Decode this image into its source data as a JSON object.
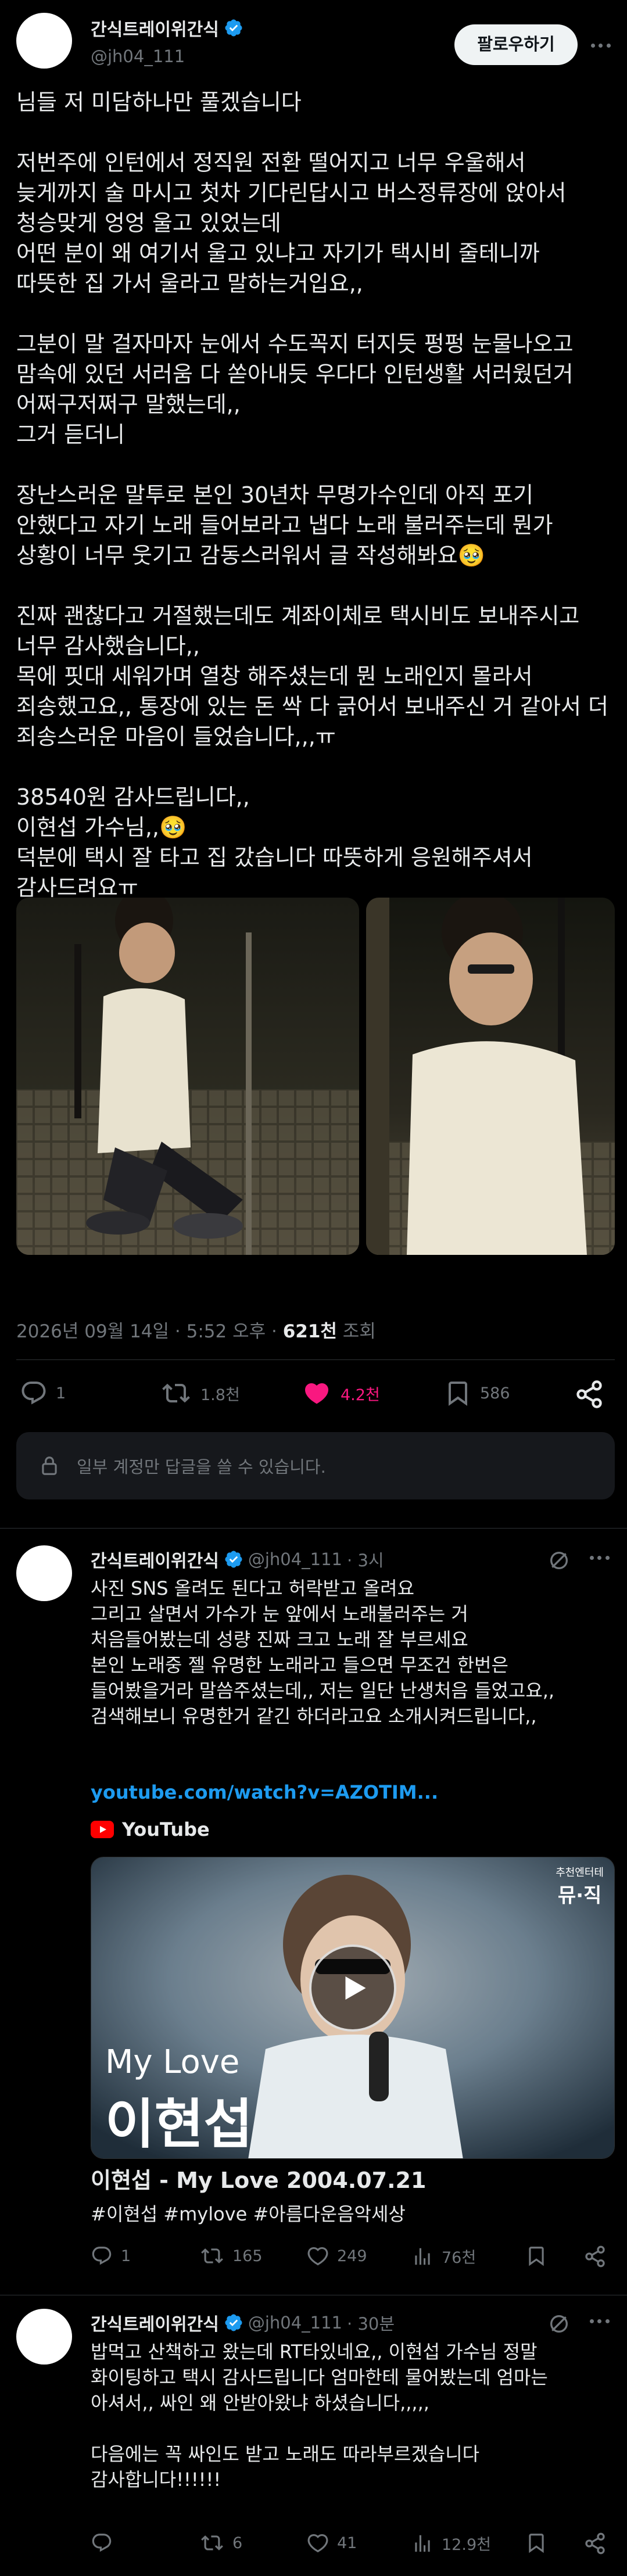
{
  "author": {
    "display_name": "간식트레이위간식",
    "handle": "@jh04_111",
    "follow_label": "팔로우하기"
  },
  "post": {
    "text": "님들 저 미담하나만 풀겠습니다\n\n저번주에 인턴에서 정직원 전환 떨어지고 너무 우울해서\n늦게까지 술 마시고 첫차 기다린답시고 버스정류장에 앉아서\n청승맞게 엉엉 울고 있었는데\n어떤 분이 왜 여기서 울고 있냐고 자기가 택시비 줄테니까\n따뜻한 집 가서 울라고 말하는거입요,,\n\n그분이 말 걸자마자 눈에서 수도꼭지 터지듯 펑펑 눈물나오고\n맘속에 있던 서러움 다 쏟아내듯 우다다 인턴생활 서러웠던거\n어쩌구저쩌구 말했는데,,\n그거 듣더니\n\n장난스러운 말투로 본인 30년차 무명가수인데 아직 포기\n안했다고 자기 노래 들어보라고 냅다 노래 불러주는데 뭔가\n상황이 너무 웃기고 감동스러워서 글 작성해봐요🥹\n\n진짜 괜찮다고 거절했는데도 계좌이체로 택시비도 보내주시고\n너무 감사했습니다,,\n목에 핏대 세워가며 열창 해주셨는데 뭔 노래인지 몰라서\n죄송했고요,, 통장에 있는 돈 싹 다 긁어서 보내주신 거 같아서 더\n죄송스러운 마음이 들었습니다,,,ㅠ\n\n38540원 감사드립니다,,\n이현섭 가수님,,🥹\n덕분에 택시 잘 타고 집 갔습니다 따뜻하게 응원해주셔서\n감사드려요ㅠ",
    "date": "2026년 09월 14일 · 5:52 오후 · ",
    "views": "621천",
    "views_label": " 조회",
    "replies": "1",
    "reposts": "1.8천",
    "likes": "4.2천",
    "bookmarks": "586",
    "reply_notice": "일부 계정만 답글을 쓸 수 있습니다."
  },
  "replies": [
    {
      "display_name": "간식트레이위간식",
      "handle": "@jh04_111",
      "time": "· 3시",
      "text": "사진 SNS 올려도 된다고 허락받고 올려요\n그리고 살면서 가수가 눈 앞에서 노래불러주는 거\n처음들어봤는데 성량 진짜 크고 노래 잘 부르세요\n본인 노래중 젤 유명한 노래라고 들으면 무조건 한번은\n들어봤을거라 말씀주셨는데,, 저는 일단 난생처음 들었고요,,\n검색해보니 유명한거 같긴 하더라고요 소개시켜드립니다,,",
      "link": "youtube.com/watch?v=AZOTIM...",
      "yt_label": "YouTube",
      "card_overlay_small": "My Love",
      "card_overlay_big": "이현섭",
      "card_badge_top": "추천엔터테",
      "card_badge_bottom": "뮤·직",
      "card_title": "이현섭 - My Love 2004.07.21",
      "hashtags": "#이현섭 #mylove #아름다운음악세상",
      "replies": "1",
      "reposts": "165",
      "likes": "249",
      "views": "76천"
    },
    {
      "display_name": "간식트레이위간식",
      "handle": "@jh04_111",
      "time": "· 30분",
      "text": "밥먹고 산책하고 왔는데 RT타있네요,, 이현섭 가수님 정말\n화이팅하고 택시 감사드립니다 엄마한테 물어봤는데 엄마는\n아셔서,, 싸인 왜 안받아왔냐 하셨습니다,,,,,\n\n다음에는 꼭 싸인도 받고 노래도 따라부르겠습니다\n감사합니다!!!!!!",
      "replies": "",
      "reposts": "6",
      "likes": "41",
      "views": "12.9천"
    }
  ],
  "colors": {
    "background": "#000000",
    "text": "#e7e9ea",
    "muted": "#71767b",
    "like": "#f91880",
    "link": "#1d9bf0",
    "verified": "#1d9bf0"
  }
}
